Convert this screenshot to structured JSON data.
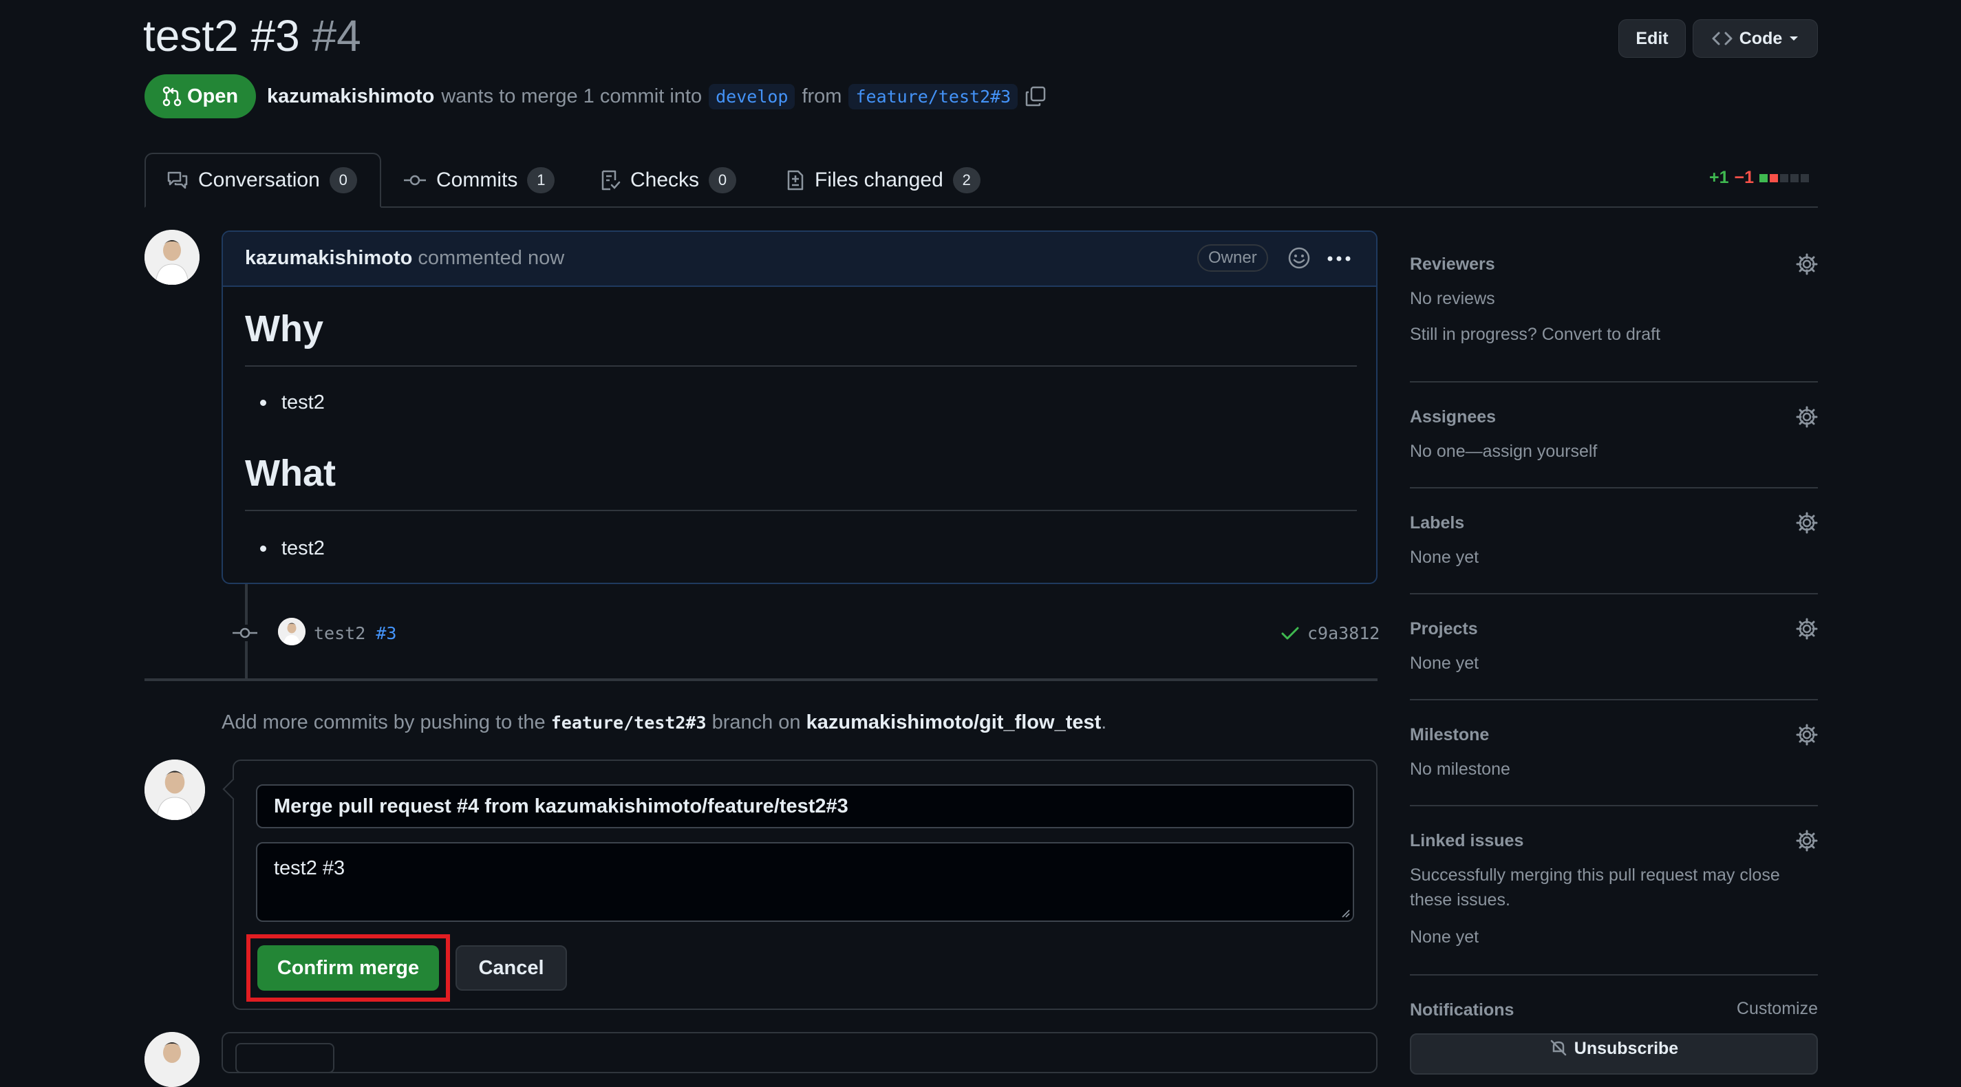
{
  "header": {
    "title": "test2 #3",
    "number": "#4",
    "edit_label": "Edit",
    "code_label": "Code"
  },
  "pr_meta": {
    "state": "Open",
    "author": "kazumakishimoto",
    "action_text": "wants to merge 1 commit into",
    "base_branch": "develop",
    "from_text": "from",
    "head_branch": "feature/test2#3"
  },
  "tabs": [
    {
      "label": "Conversation",
      "count": "0",
      "icon": "comment-discussion-icon"
    },
    {
      "label": "Commits",
      "count": "1",
      "icon": "git-commit-icon"
    },
    {
      "label": "Checks",
      "count": "0",
      "icon": "checklist-icon"
    },
    {
      "label": "Files changed",
      "count": "2",
      "icon": "file-diff-icon"
    }
  ],
  "diffstat": {
    "additions": "+1",
    "deletions": "−1"
  },
  "comment": {
    "author": "kazumakishimoto",
    "action": "commented now",
    "role_badge": "Owner",
    "body": {
      "heading1": "Why",
      "item1": "test2",
      "heading2": "What",
      "item2": "test2"
    }
  },
  "commit": {
    "message": "test2",
    "ref": "#3",
    "sha": "c9a3812"
  },
  "hint": {
    "prefix": "Add more commits by pushing to the",
    "branch": "feature/test2#3",
    "middle": "branch on",
    "repo": "kazumakishimoto/git_flow_test",
    "suffix": "."
  },
  "merge_form": {
    "title_value": "Merge pull request #4 from kazumakishimoto/feature/test2#3",
    "body_value": "test2 #3",
    "confirm_label": "Confirm merge",
    "cancel_label": "Cancel"
  },
  "sidebar": {
    "reviewers": {
      "heading": "Reviewers",
      "value": "No reviews",
      "extra": "Still in progress? Convert to draft"
    },
    "assignees": {
      "heading": "Assignees",
      "value": "No one—assign yourself"
    },
    "labels": {
      "heading": "Labels",
      "value": "None yet"
    },
    "projects": {
      "heading": "Projects",
      "value": "None yet"
    },
    "milestone": {
      "heading": "Milestone",
      "value": "No milestone"
    },
    "linked_issues": {
      "heading": "Linked issues",
      "description": "Successfully merging this pull request may close these issues.",
      "value": "None yet"
    },
    "notifications": {
      "heading": "Notifications",
      "customize": "Customize",
      "button": "Unsubscribe"
    }
  },
  "colors": {
    "background": "#0d1117",
    "open_green": "#238636",
    "link_blue": "#4493f8",
    "highlight_red": "#e11d22"
  }
}
